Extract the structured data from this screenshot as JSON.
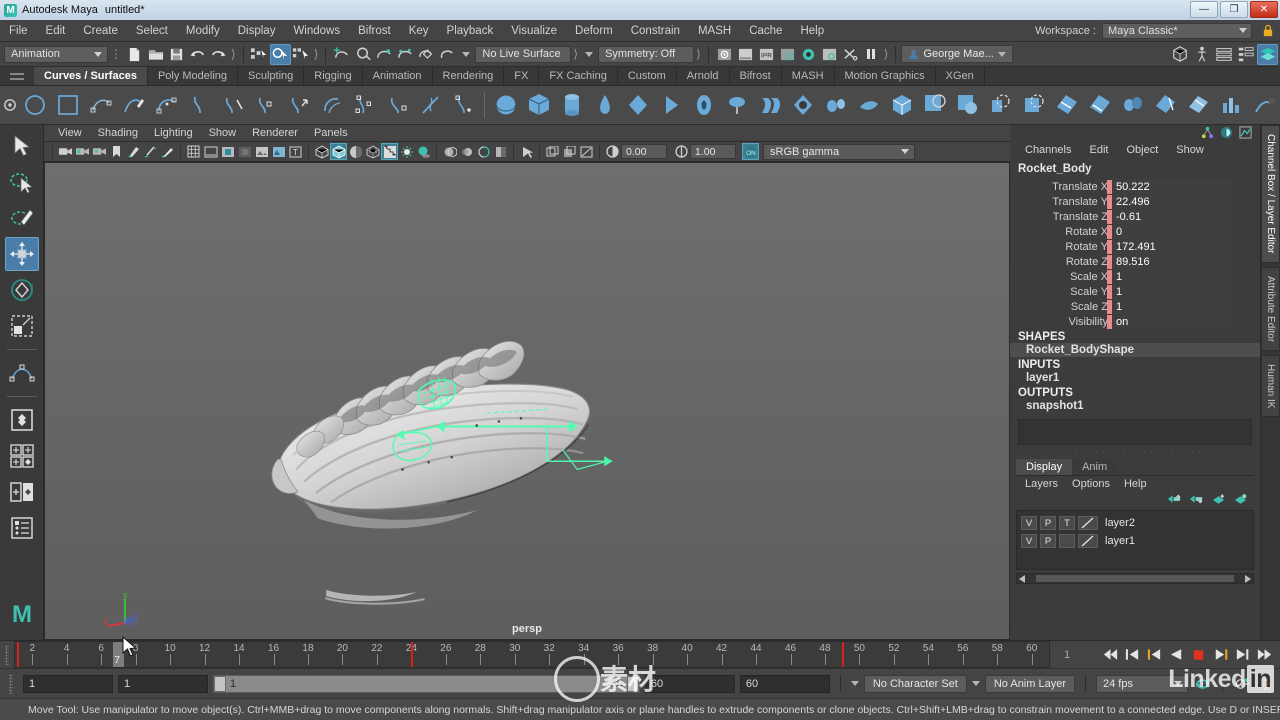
{
  "window": {
    "app_name": "Autodesk Maya",
    "document": "untitled*",
    "logo_letter": "M",
    "minimize": "—",
    "restore": "❐",
    "close": "✕"
  },
  "menubar": {
    "items": [
      "File",
      "Edit",
      "Create",
      "Select",
      "Modify",
      "Display",
      "Windows",
      "Bifrost",
      "Key",
      "Playback",
      "Visualize",
      "Deform",
      "Constrain",
      "MASH",
      "Cache",
      "Help"
    ],
    "workspace_label": "Workspace :",
    "workspace_value": "Maya Classic*"
  },
  "statusline": {
    "mode": "Animation",
    "live_surface": "No Live Surface",
    "symmetry": "Symmetry: Off",
    "user": "George Mae...",
    "icons": [
      "new-scene-icon",
      "open-scene-icon",
      "save-scene-icon",
      "undo-icon",
      "redo-icon",
      "select-hierarchy-icon",
      "select-object-icon",
      "select-component-icon",
      "snap-grid-icon",
      "snap-curve-icon",
      "snap-point-icon",
      "snap-projected-icon",
      "snap-view-plane-icon",
      "magnet-icon",
      "render-current-frame-icon",
      "ipr-render-icon",
      "render-settings-icon",
      "hypershade-icon",
      "render-view-icon",
      "light-icon",
      "pause-icon"
    ]
  },
  "shelf": {
    "tabs": [
      "Curves / Surfaces",
      "Poly Modeling",
      "Sculpting",
      "Rigging",
      "Animation",
      "Rendering",
      "FX",
      "FX Caching",
      "Custom",
      "Arnold",
      "Bifrost",
      "MASH",
      "Motion Graphics",
      "XGen"
    ],
    "active_tab": "Curves / Surfaces"
  },
  "toolbox": {
    "items": [
      "select-tool",
      "lasso-select-tool",
      "paint-select-tool",
      "move-tool",
      "rotate-tool",
      "scale-tool",
      "soft-select-tool",
      "snap-layout-icon",
      "layout-2panes-icon",
      "layout-quad-icon",
      "layout-single-icon",
      "outliner-icon",
      "maya-logo-icon"
    ],
    "active": "move-tool"
  },
  "viewport": {
    "menus": [
      "View",
      "Shading",
      "Lighting",
      "Show",
      "Renderer",
      "Panels"
    ],
    "exposure_value": "0.00",
    "gamma_value": "1.00",
    "color_space": "sRGB gamma",
    "camera_label": "persp",
    "axis_x": "x",
    "axis_y": "y",
    "axis_z": "z",
    "toolbar_icons": [
      "camera-icon",
      "camera-bookmark-icon",
      "camera-attributes-icon",
      "bookmark-icon",
      "paint-effects-icon",
      "grease-pencil-icon",
      "brush-icon",
      "grid-icon",
      "film-gate-icon",
      "resolution-gate-icon",
      "gate-mask-icon",
      "image-plane-icon",
      "texture-icon",
      "text-icon",
      "wireframe-icon",
      "smooth-shade-icon",
      "shaded-wire-icon",
      "flat-shade-icon",
      "textured-icon",
      "lights-icon",
      "shadows-icon",
      "ao-icon",
      "motion-blur-icon",
      "aa-icon",
      "xray-icon",
      "isolate-select-icon",
      "exposure-icon",
      "gamma-icon",
      "color-management-icon"
    ]
  },
  "channelbox": {
    "menus": [
      "Channels",
      "Edit",
      "Object",
      "Show"
    ],
    "object_name": "Rocket_Body",
    "attributes": [
      {
        "name": "Translate X",
        "value": "50.222"
      },
      {
        "name": "Translate Y",
        "value": "22.496"
      },
      {
        "name": "Translate Z",
        "value": "-0.61"
      },
      {
        "name": "Rotate X",
        "value": "0"
      },
      {
        "name": "Rotate Y",
        "value": "172.491"
      },
      {
        "name": "Rotate Z",
        "value": "89.516"
      },
      {
        "name": "Scale X",
        "value": "1"
      },
      {
        "name": "Scale Y",
        "value": "1"
      },
      {
        "name": "Scale Z",
        "value": "1"
      },
      {
        "name": "Visibility",
        "value": "on"
      }
    ],
    "sections": [
      {
        "label": "SHAPES",
        "items": [
          "Rocket_BodyShape"
        ]
      },
      {
        "label": "INPUTS",
        "items": [
          "layer1"
        ]
      },
      {
        "label": "OUTPUTS",
        "items": [
          "snapshot1"
        ]
      }
    ],
    "side_tabs": [
      "Channel Box / Layer Editor",
      "Attribute Editor",
      "Human IK"
    ],
    "active_side_tab": "Channel Box / Layer Editor"
  },
  "layereditor": {
    "tabs": [
      "Display",
      "Anim"
    ],
    "active_tab": "Display",
    "menus": [
      "Layers",
      "Options",
      "Help"
    ],
    "buttons": [
      "move-layer-up-icon",
      "move-layer-down-icon",
      "new-layer-icon",
      "new-layer-from-selected-icon"
    ],
    "layers": [
      {
        "v": "V",
        "p": "P",
        "t": "T",
        "name": "layer2"
      },
      {
        "v": "V",
        "p": "P",
        "t": "",
        "name": "layer1"
      }
    ]
  },
  "timeline": {
    "ticks": [
      2,
      4,
      6,
      8,
      10,
      12,
      14,
      16,
      18,
      20,
      22,
      24,
      26,
      28,
      30,
      32,
      34,
      36,
      38,
      40,
      42,
      44,
      46,
      48,
      50,
      52,
      54,
      56,
      58,
      60
    ],
    "range_start": 1,
    "range_end": 60,
    "current_frame": 7,
    "cursor_frame_label": "7",
    "range_marker_left": 24,
    "range_marker_right": 49,
    "current_field": "1",
    "playback_buttons": [
      "go-to-start-icon",
      "step-back-keyframe-icon",
      "step-back-frame-icon",
      "play-backwards-icon",
      "stop-icon",
      "play-forwards-icon",
      "step-forward-frame-icon",
      "go-to-end-icon"
    ]
  },
  "rangeslider": {
    "start_field": "1",
    "end_field": "1",
    "range_start_label": "1",
    "range_end_label": "60",
    "anim_start_field": "60",
    "anim_end_field": "60",
    "character_set": "No Character Set",
    "anim_layer": "No Anim Layer",
    "fps": "24 fps",
    "icons": [
      "auto-key-icon",
      "animation-preferences-icon",
      "cycle-icon"
    ]
  },
  "helpline": {
    "text": "Move Tool: Use manipulator to move object(s). Ctrl+MMB+drag to move components along normals. Shift+drag manipulator axis or plane handles to extrude components or clone objects. Ctrl+Shift+LMB+drag to constrain movement to a connected edge. Use D or INSERT to change the pivot position"
  },
  "watermarks": {
    "linkedin": "Linked",
    "linkedin_box": "in"
  },
  "colors": {
    "accent_blue": "#4a7ea8",
    "shelf_icon_blue": "#6aa9d8",
    "keyed_pink": "#e98b8b",
    "range_red": "#d82020",
    "teal": "#3fc0b0"
  }
}
